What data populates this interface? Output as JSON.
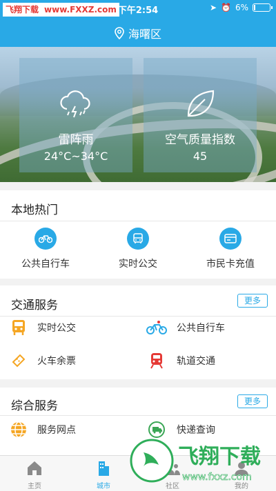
{
  "statusbar": {
    "watermark_left": "飞翔下载",
    "watermark_url": "www.FXXZ.com",
    "time": "下午2:54",
    "battery": "6%",
    "battery_level": 0.06
  },
  "location": {
    "name": "海曙区"
  },
  "weather": {
    "condition": "雷阵雨",
    "temp_range": "24°C~34°C",
    "aqi_label": "空气质量指数",
    "aqi_value": "45"
  },
  "hot": {
    "title": "本地热门",
    "items": [
      {
        "label": "公共自行车",
        "icon": "bicycle-icon"
      },
      {
        "label": "实时公交",
        "icon": "bus-icon"
      },
      {
        "label": "市民卡充值",
        "icon": "card-icon"
      }
    ]
  },
  "traffic": {
    "title": "交通服务",
    "more": "更多",
    "items": [
      {
        "label": "实时公交",
        "icon": "bus-icon",
        "color": "#f5a623"
      },
      {
        "label": "公共自行车",
        "icon": "bicycle-icon",
        "color": "#29a9e6"
      },
      {
        "label": "火车余票",
        "icon": "ticket-icon",
        "color": "#f5a623"
      },
      {
        "label": "轨道交通",
        "icon": "metro-icon",
        "color": "#e53935"
      }
    ]
  },
  "general": {
    "title": "综合服务",
    "more": "更多",
    "items": [
      {
        "label": "服务网点",
        "icon": "globe-icon",
        "color": "#f5a623"
      },
      {
        "label": "快递查询",
        "icon": "express-icon",
        "color": "#3aa655"
      }
    ]
  },
  "tabs": [
    {
      "label": "主页",
      "icon": "home-icon"
    },
    {
      "label": "城市",
      "icon": "city-icon",
      "active": true
    },
    {
      "label": "社区",
      "icon": "community-icon"
    },
    {
      "label": "我的",
      "icon": "profile-icon"
    }
  ],
  "watermark": {
    "brand": "飞翔下载",
    "url": "www.fxxz.com"
  },
  "colors": {
    "primary": "#29a9e6",
    "orange": "#f5a623",
    "red": "#e53935"
  }
}
